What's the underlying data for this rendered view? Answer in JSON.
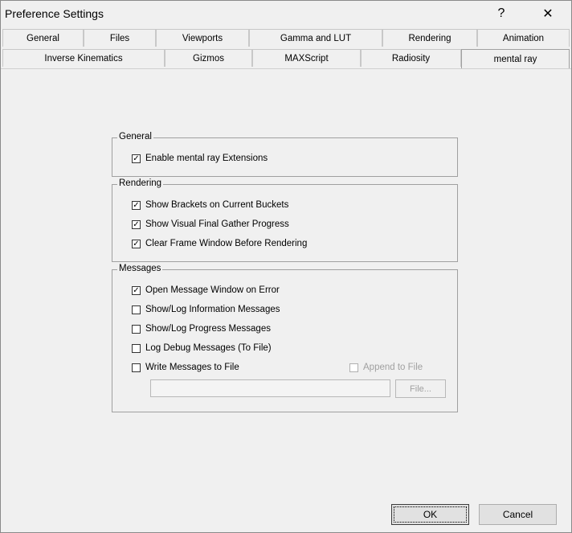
{
  "window": {
    "title": "Preference Settings",
    "help_label": "?",
    "close_label": "✕"
  },
  "tabs": {
    "row1": [
      "General",
      "Files",
      "Viewports",
      "Gamma and LUT",
      "Rendering",
      "Animation"
    ],
    "row2": [
      "Inverse Kinematics",
      "Gizmos",
      "MAXScript",
      "Radiosity",
      "mental ray"
    ],
    "active": "mental ray"
  },
  "groups": {
    "general": {
      "label": "General",
      "enable_extensions": {
        "label": "Enable mental ray Extensions",
        "checked": true
      }
    },
    "rendering": {
      "label": "Rendering",
      "show_brackets": {
        "label": "Show Brackets on Current Buckets",
        "checked": true
      },
      "show_fg_progress": {
        "label": "Show Visual Final Gather Progress",
        "checked": true
      },
      "clear_frame": {
        "label": "Clear Frame Window Before Rendering",
        "checked": true
      }
    },
    "messages": {
      "label": "Messages",
      "open_on_error": {
        "label": "Open Message Window on Error",
        "checked": true
      },
      "log_info": {
        "label": "Show/Log Information Messages",
        "checked": false
      },
      "log_progress": {
        "label": "Show/Log Progress Messages",
        "checked": false
      },
      "log_debug": {
        "label": "Log Debug Messages (To File)",
        "checked": false
      },
      "write_to_file": {
        "label": "Write Messages to File",
        "checked": false
      },
      "append_to_file": {
        "label": "Append to File",
        "checked": false,
        "disabled": true
      },
      "file_path_value": "",
      "file_button_label": "File..."
    }
  },
  "buttons": {
    "ok_label": "OK",
    "cancel_label": "Cancel"
  }
}
